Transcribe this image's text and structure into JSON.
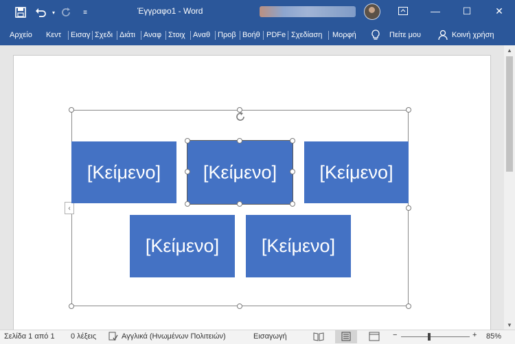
{
  "titlebar": {
    "save_icon": "save-icon",
    "undo_icon": "undo-icon",
    "redo_icon": "redo-icon",
    "customize_icon": "customize-qat-icon",
    "doc_title": "Έγγραφο1 - Word",
    "ribbon_display_icon": "ribbon-display-options-icon",
    "minimize": "—",
    "maximize": "☐",
    "close": "✕"
  },
  "ribbon": {
    "tabs": [
      "Αρχείο",
      "Κεντ",
      "Εισαγ",
      "Σχεδι",
      "Διάτι",
      "Αναφ",
      "Στοιχ",
      "Αναθ",
      "Προβ",
      "Βοήθ",
      "PDFe",
      "Σχεδίαση",
      "Μορφή"
    ],
    "tell_me": "Πείτε μου",
    "share": "Κοινή χρήση"
  },
  "smartart": {
    "boxes": [
      "[Κείμενο]",
      "[Κείμενο]",
      "[Κείμενο]",
      "[Κείμενο]",
      "[Κείμενο]"
    ],
    "box_color": "#4472c4"
  },
  "statusbar": {
    "page": "Σελίδα 1 από 1",
    "words": "0 λέξεις",
    "language": "Αγγλικά (Ηνωμένων Πολιτειών)",
    "mode": "Εισαγωγή",
    "zoom": "85%",
    "zoom_out": "−",
    "zoom_in": "+"
  },
  "colors": {
    "brand": "#2b579a",
    "shape": "#4472c4"
  }
}
